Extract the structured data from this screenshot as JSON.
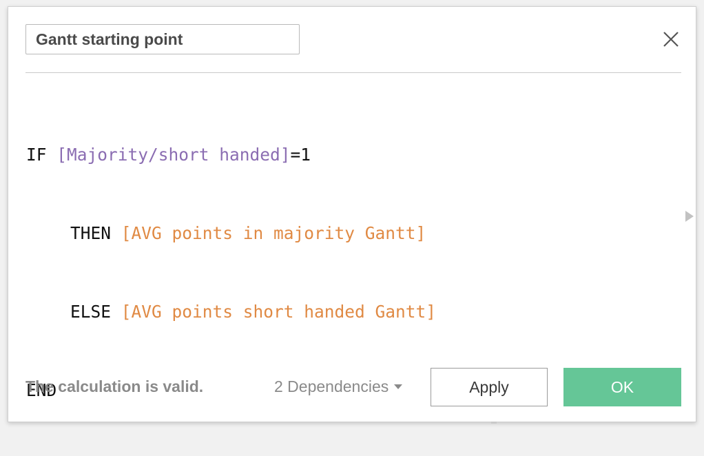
{
  "dialog": {
    "calc_name": "Gantt starting point",
    "close_icon": "close-icon",
    "expand_icon": "chevron-right-icon"
  },
  "formula": {
    "line1": {
      "kw": "IF",
      "param": "[Majority/short handed]",
      "op": "=1"
    },
    "line2": {
      "kw": "THEN",
      "field": "[AVG points in majority Gantt]"
    },
    "line3": {
      "kw": "ELSE",
      "field": "[AVG points short handed Gantt]"
    },
    "line4": {
      "kw": "END"
    }
  },
  "footer": {
    "status": "The calculation is valid.",
    "dependencies": "2 Dependencies",
    "apply_label": "Apply",
    "ok_label": "OK"
  },
  "colors": {
    "parameter": "#8b6db2",
    "field": "#e08a44",
    "ok_button": "#65c697"
  }
}
